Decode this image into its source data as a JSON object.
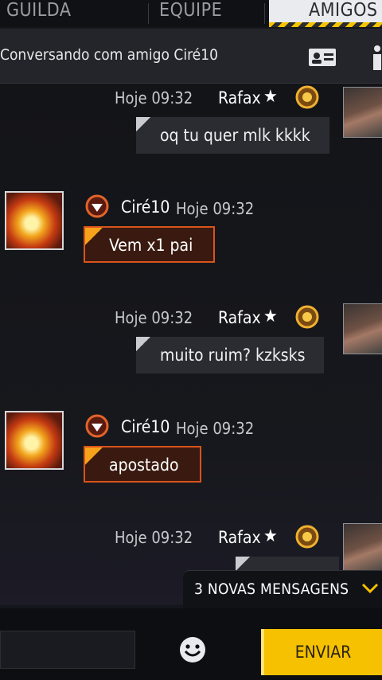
{
  "tabs": [
    "GUILDA",
    "EQUIPE",
    "AMIGOS"
  ],
  "active_tab": "AMIGOS",
  "header": {
    "title": "Conversando com amigo Ciré10"
  },
  "messages": [
    {
      "side": "right",
      "sender": "Rafax",
      "time": "Hoje 09:32",
      "text": "oq tu quer mlk kkkk"
    },
    {
      "side": "left",
      "sender": "Ciré10",
      "time": "Hoje 09:32",
      "text": "Vem x1 pai"
    },
    {
      "side": "right",
      "sender": "Rafax",
      "time": "Hoje 09:32",
      "text": "muito ruim? kzksks"
    },
    {
      "side": "left",
      "sender": "Ciré10",
      "time": "Hoje 09:32",
      "text": "apostado"
    },
    {
      "side": "right",
      "sender": "Rafax",
      "time": "Hoje 09:32",
      "text": ""
    }
  ],
  "star_glyph": "★",
  "new_messages": {
    "label": "3 NOVAS MENSAGENS"
  },
  "input": {
    "value": "",
    "placeholder": ""
  },
  "send_button": {
    "label": "ENVIAR"
  },
  "colors": {
    "accent_yellow": "#f5c100",
    "friend_bubble_border": "#d9531c",
    "my_bubble": "#2b2c32"
  },
  "icons": [
    "profile-card-icon",
    "info-icon",
    "rank-badge-icon",
    "star-icon",
    "emoji-icon",
    "chevron-down-icon"
  ]
}
